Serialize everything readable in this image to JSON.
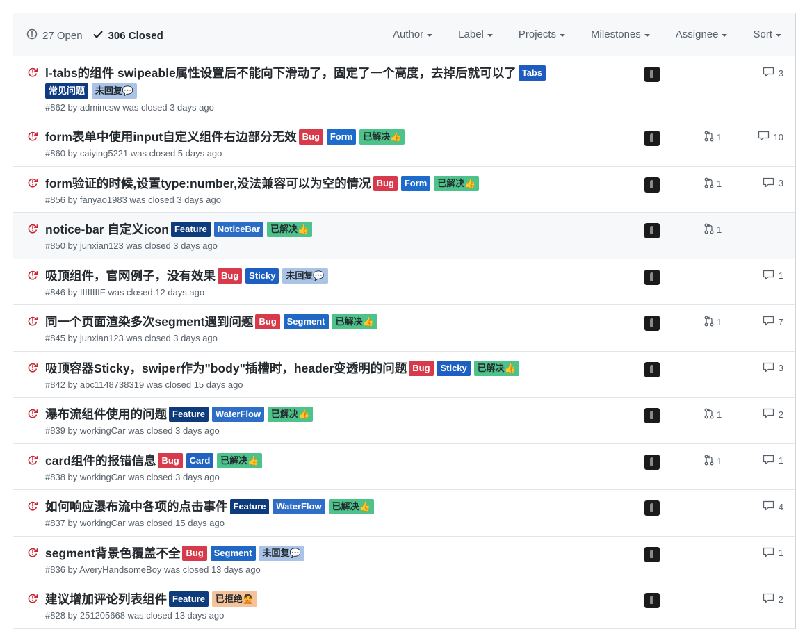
{
  "header": {
    "open_label": "27 Open",
    "closed_label": "306 Closed",
    "filters": [
      "Author",
      "Label",
      "Projects",
      "Milestones",
      "Assignee",
      "Sort"
    ]
  },
  "label_colors": {
    "Tabs": {
      "bg": "#1d5bbf",
      "fg": "#ffffff"
    },
    "常见问题": {
      "bg": "#0c3b84",
      "fg": "#ffffff"
    },
    "未回复💬": {
      "bg": "#a9c4e6",
      "fg": "#24292e"
    },
    "Bug": {
      "bg": "#d73a4a",
      "fg": "#ffffff"
    },
    "Form": {
      "bg": "#1d6bcb",
      "fg": "#ffffff"
    },
    "已解决👍": {
      "bg": "#4dc38b",
      "fg": "#24292e"
    },
    "Feature": {
      "bg": "#0e3b7c",
      "fg": "#ffffff"
    },
    "NoticeBar": {
      "bg": "#2b6dc6",
      "fg": "#ffffff"
    },
    "Sticky": {
      "bg": "#1d5fc2",
      "fg": "#ffffff"
    },
    "Segment": {
      "bg": "#1f68c4",
      "fg": "#ffffff"
    },
    "WaterFlow": {
      "bg": "#2f6ec7",
      "fg": "#ffffff"
    },
    "Card": {
      "bg": "#2263c0",
      "fg": "#ffffff"
    },
    "已拒绝🙅": {
      "bg": "#f5c39b",
      "fg": "#24292e"
    }
  },
  "issues": [
    {
      "title": "l-tabs的组件 swipeable属性设置后不能向下滑动了，固定了一个高度，去掉后就可以了",
      "labels": [
        "Tabs",
        "常见问题",
        "未回复💬"
      ],
      "meta": "#862 by admincsw was closed 3 days ago",
      "pr": "",
      "comments": "3"
    },
    {
      "title": "form表单中使用input自定义组件右边部分无效",
      "labels": [
        "Bug",
        "Form",
        "已解决👍"
      ],
      "meta": "#860 by caiying5221 was closed 5 days ago",
      "pr": "1",
      "comments": "10"
    },
    {
      "title": "form验证的时候,设置type:number,没法兼容可以为空的情况",
      "labels": [
        "Bug",
        "Form",
        "已解决👍"
      ],
      "meta": "#856 by fanyao1983 was closed 3 days ago",
      "pr": "1",
      "comments": "3"
    },
    {
      "title": "notice-bar 自定义icon",
      "labels": [
        "Feature",
        "NoticeBar",
        "已解决👍"
      ],
      "meta": "#850 by junxian123 was closed 3 days ago",
      "pr": "1",
      "comments": ""
    },
    {
      "title": "吸顶组件，官网例子，没有效果",
      "labels": [
        "Bug",
        "Sticky",
        "未回复💬"
      ],
      "meta": "#846 by IIIIIIIIF was closed 12 days ago",
      "pr": "",
      "comments": "1"
    },
    {
      "title": "同一个页面渲染多次segment遇到问题",
      "labels": [
        "Bug",
        "Segment",
        "已解决👍"
      ],
      "meta": "#845 by junxian123 was closed 3 days ago",
      "pr": "1",
      "comments": "7"
    },
    {
      "title": "吸顶容器Sticky，swiper作为\"body\"插槽时，header变透明的问题",
      "labels": [
        "Bug",
        "Sticky",
        "已解决👍"
      ],
      "meta": "#842 by abc1148738319 was closed 15 days ago",
      "pr": "",
      "comments": "3"
    },
    {
      "title": "瀑布流组件使用的问题",
      "labels": [
        "Feature",
        "WaterFlow",
        "已解决👍"
      ],
      "meta": "#839 by workingCar was closed 3 days ago",
      "pr": "1",
      "comments": "2"
    },
    {
      "title": "card组件的报错信息",
      "labels": [
        "Bug",
        "Card",
        "已解决👍"
      ],
      "meta": "#838 by workingCar was closed 3 days ago",
      "pr": "1",
      "comments": "1"
    },
    {
      "title": "如何响应瀑布流中各项的点击事件",
      "labels": [
        "Feature",
        "WaterFlow",
        "已解决👍"
      ],
      "meta": "#837 by workingCar was closed 15 days ago",
      "pr": "",
      "comments": "4"
    },
    {
      "title": "segment背景色覆盖不全",
      "labels": [
        "Bug",
        "Segment",
        "未回复💬"
      ],
      "meta": "#836 by AveryHandsomeBoy was closed 13 days ago",
      "pr": "",
      "comments": "1"
    },
    {
      "title": "建议增加评论列表组件",
      "labels": [
        "Feature",
        "已拒绝🙅"
      ],
      "meta": "#828 by 251205668 was closed 13 days ago",
      "pr": "",
      "comments": "2"
    }
  ]
}
